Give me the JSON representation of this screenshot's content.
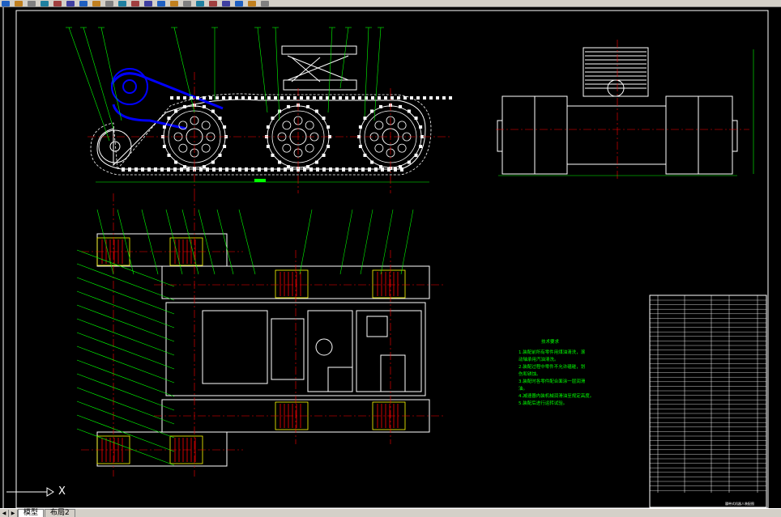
{
  "toolbar": {
    "icons": [
      "open-icon",
      "save-icon",
      "print-icon",
      "preview-icon",
      "publish-icon",
      "undo-icon",
      "redo-icon",
      "pan-icon",
      "zoom-realtime-icon",
      "zoom-window-icon",
      "zoom-previous-icon",
      "properties-icon",
      "designcenter-icon",
      "toolpalettes-icon",
      "sheetset-icon",
      "markup-icon",
      "calculator-icon",
      "help-icon",
      "layer-icon",
      "layer-state-icon",
      "color-icon"
    ]
  },
  "drawing": {
    "tech_notes_title": "技术要求",
    "tech_notes": [
      "1.装配前所有零件用煤油清洗，滚",
      "  动轴承用汽油清洗。",
      "2.装配过程中零件不允许磕碰，划",
      "  伤和锈蚀。",
      "3.装配时各零件配合面涂一层润滑",
      "  油。",
      "4.减速器内装机械润滑油至规定高度。",
      "5.装配后进行运转试验。"
    ],
    "title_block_caption": "履带式机器人装配图"
  },
  "ucs": {
    "label": "X"
  },
  "tabs": [
    {
      "label": "模型",
      "active": true
    },
    {
      "label": "布局2",
      "active": false
    }
  ],
  "colors": {
    "background": "#000000",
    "outline": "#ffffff",
    "center_line": "#ff0000",
    "leader": "#00ff00",
    "belt": "#0000ff",
    "hidden": "#ff00ff",
    "yellow": "#ffff00"
  }
}
